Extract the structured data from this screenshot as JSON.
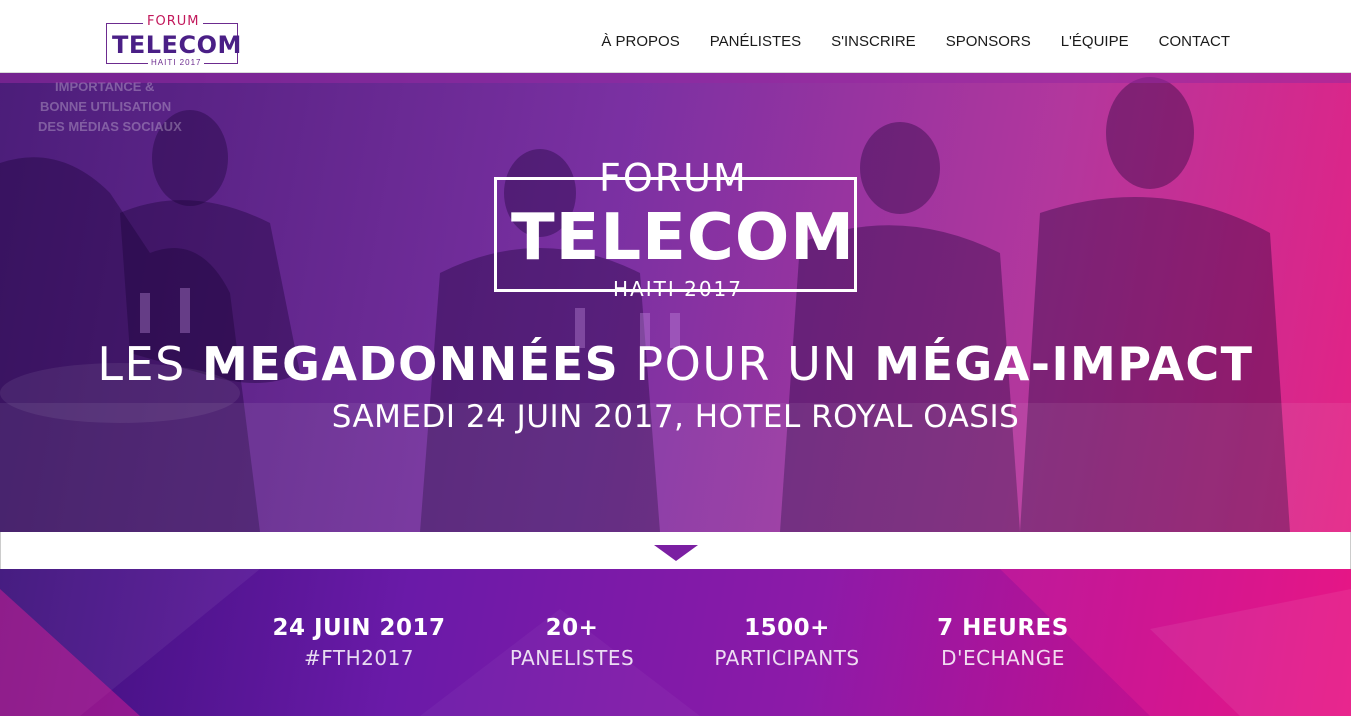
{
  "header": {
    "logo": {
      "forum": "FORUM",
      "telecom": "TELECOM",
      "haiti": "HAITI 2017"
    },
    "nav": [
      {
        "label": "À PROPOS"
      },
      {
        "label": "PANÉLISTES"
      },
      {
        "label": "S'INSCRIRE"
      },
      {
        "label": "SPONSORS"
      },
      {
        "label": "L'ÉQUIPE"
      },
      {
        "label": "CONTACT"
      }
    ]
  },
  "hero": {
    "logo": {
      "forum": "FORUM",
      "telecom": "TELECOM",
      "haiti": "HAITI 2017"
    },
    "headline": {
      "part1": "LES ",
      "part2": "MEGADONNÉES",
      "part3": " POUR UN ",
      "part4": "MÉGA-IMPACT"
    },
    "subline": "SAMEDI 24 JUIN 2017, HOTEL ROYAL OASIS",
    "banner_text": "IMPORTANCE & BONNE UTILISATION DES MÉDIAS SOCIAUX"
  },
  "stats": [
    {
      "value": "24 JUIN 2017",
      "label": "#FTH2017"
    },
    {
      "value": "20+",
      "label": "PANELISTES"
    },
    {
      "value": "1500+",
      "label": "PARTICIPANTS"
    },
    {
      "value": "7 HEURES",
      "label": "D'ECHANGE"
    }
  ],
  "colors": {
    "brand_purple": "#4a1f86",
    "brand_magenta": "#c2185b",
    "hero_gradient_start": "#3c0a6e",
    "hero_gradient_end": "#e10a78",
    "arrow": "#7b1fa2"
  }
}
